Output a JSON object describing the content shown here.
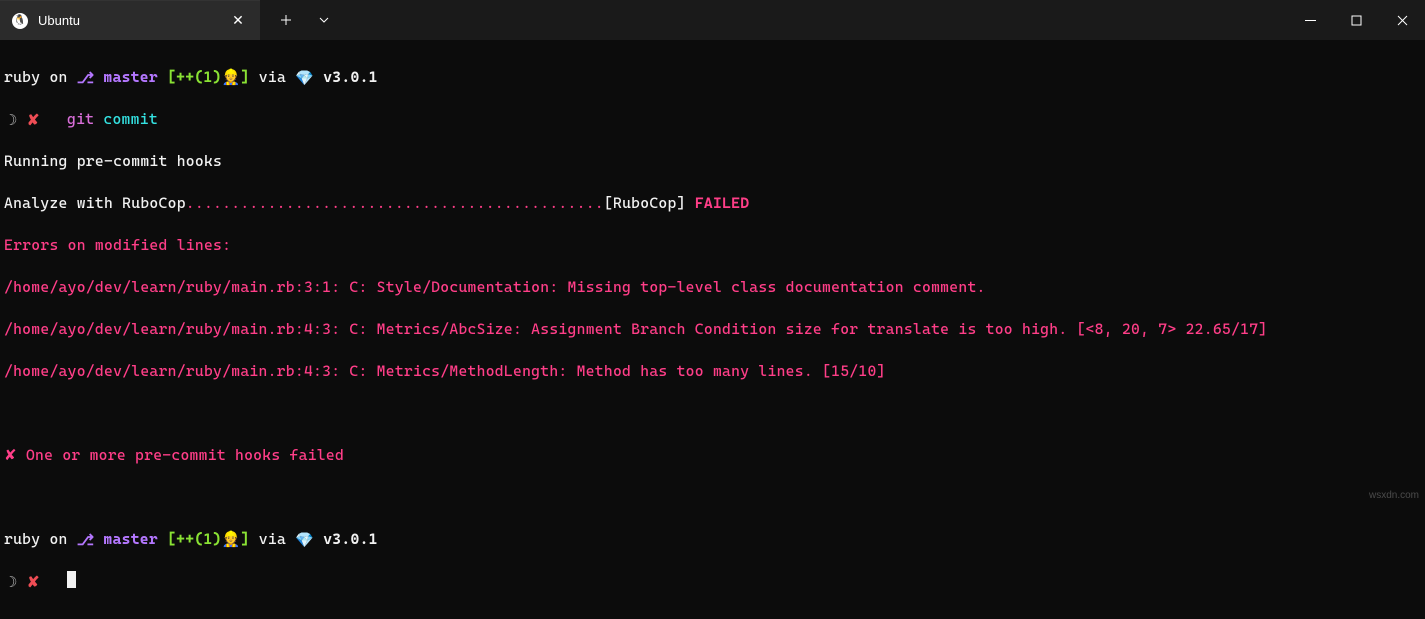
{
  "window": {
    "tab_title": "Ubuntu"
  },
  "prompt1": {
    "app": "ruby",
    "on": "on",
    "branch_icon": "⎇",
    "branch": "master",
    "status": "[++(1)👷]",
    "via": "via",
    "gem": "💎",
    "version": "v3.0.1",
    "prompt_symbol": "☽",
    "fail_marker": "✘",
    "cmd_git": "git",
    "cmd_commit": "commit"
  },
  "output": {
    "running": "Running pre-commit hooks",
    "analyze_prefix": "Analyze with RuboCop",
    "dots": "..............................................",
    "rubocop_tag": "[RuboCop]",
    "failed": "FAILED",
    "errors_header": "Errors on modified lines:",
    "err1": "/home/ayo/dev/learn/ruby/main.rb:3:1: C: Style/Documentation: Missing top-level class documentation comment.",
    "err2": "/home/ayo/dev/learn/ruby/main.rb:4:3: C: Metrics/AbcSize: Assignment Branch Condition size for translate is too high. [<8, 20, 7> 22.65/17]",
    "err3": "/home/ayo/dev/learn/ruby/main.rb:4:3: C: Metrics/MethodLength: Method has too many lines. [15/10]",
    "hook_fail": "✘ One or more pre-commit hooks failed"
  },
  "prompt2": {
    "app": "ruby",
    "on": "on",
    "branch_icon": "⎇",
    "branch": "master",
    "status": "[++(1)👷]",
    "via": "via",
    "gem": "💎",
    "version": "v3.0.1",
    "prompt_symbol": "☽",
    "fail_marker": "✘"
  },
  "watermark": "wsxdn.com"
}
